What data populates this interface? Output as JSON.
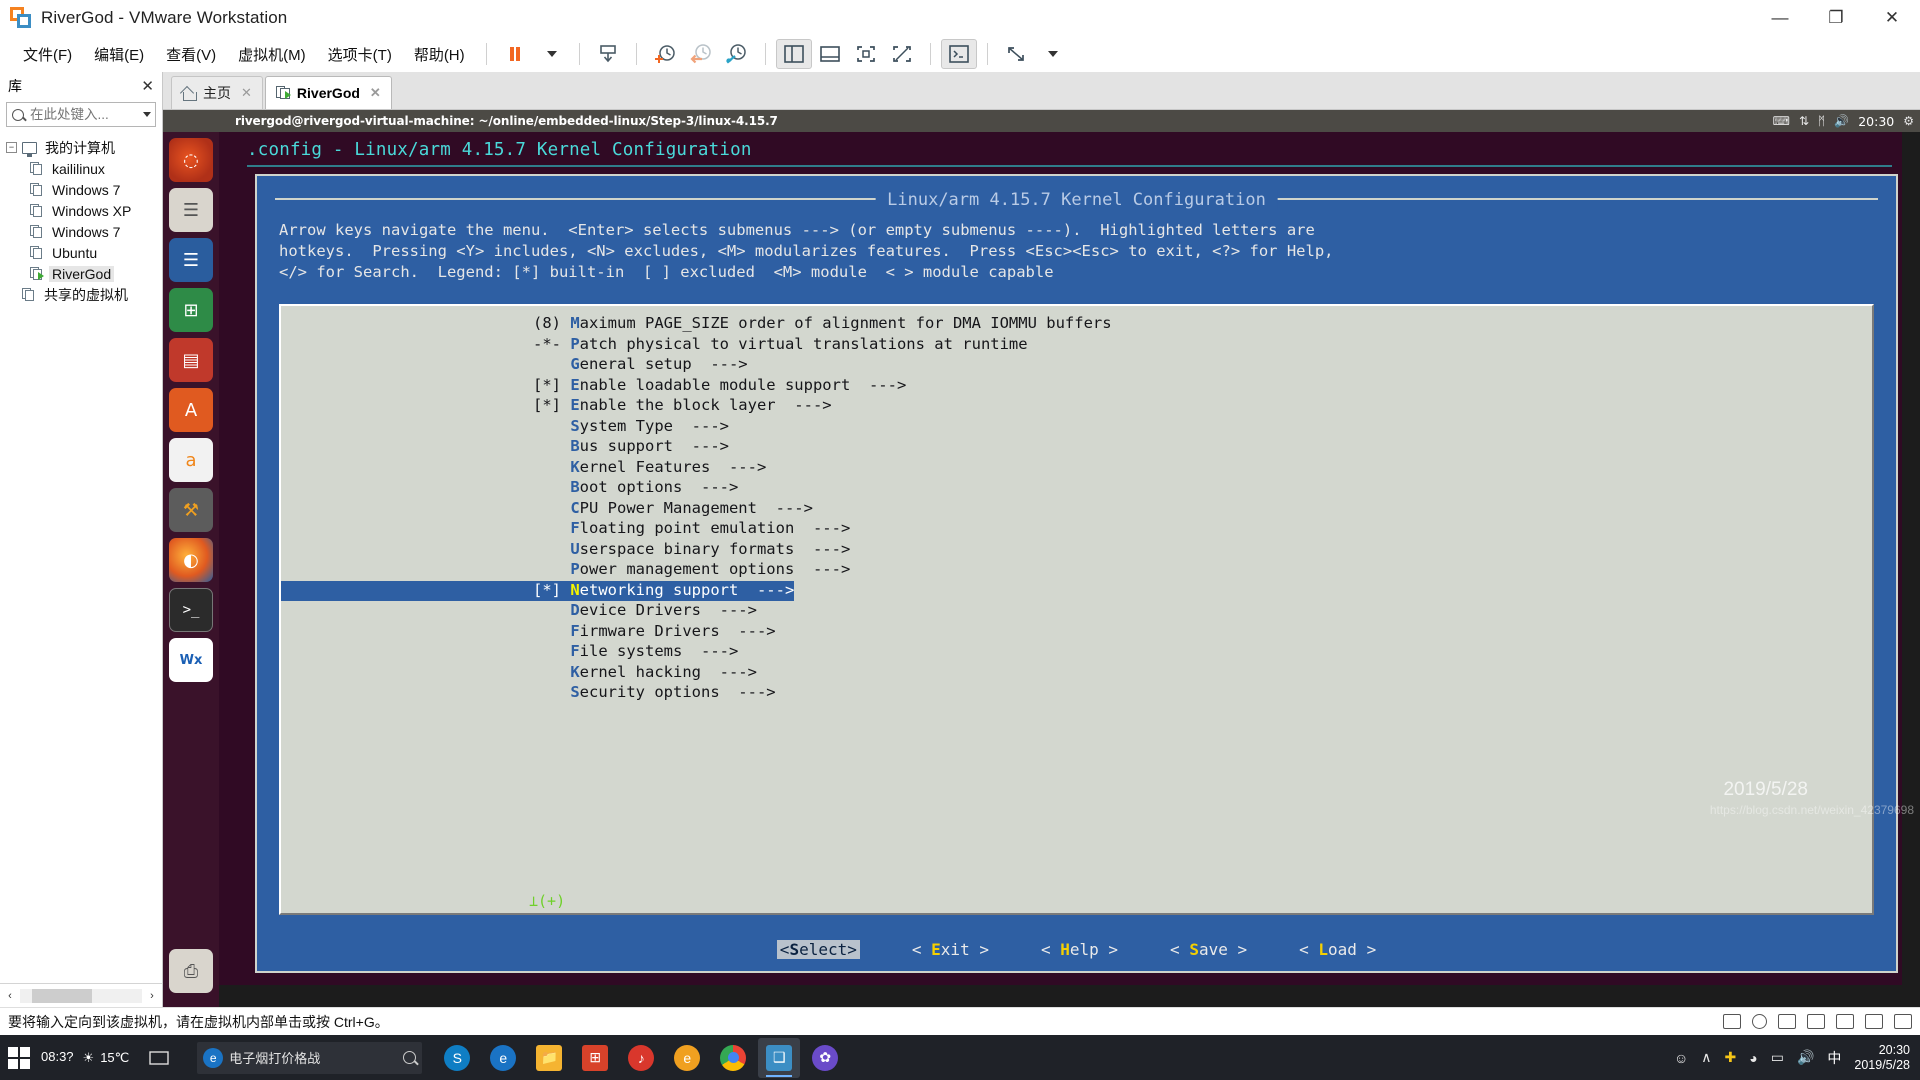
{
  "window": {
    "title": "RiverGod - VMware Workstation",
    "logo_icon": "vmware-logo-icon",
    "controls": {
      "minimize": "—",
      "maximize": "❐",
      "close": "✕"
    }
  },
  "menubar": {
    "items": [
      {
        "label": "文件(F)",
        "name": "menu-file"
      },
      {
        "label": "编辑(E)",
        "name": "menu-edit"
      },
      {
        "label": "查看(V)",
        "name": "menu-view"
      },
      {
        "label": "虚拟机(M)",
        "name": "menu-vm"
      },
      {
        "label": "选项卡(T)",
        "name": "menu-tabs"
      },
      {
        "label": "帮助(H)",
        "name": "menu-help"
      }
    ],
    "toolbar": [
      {
        "name": "suspend-button",
        "icon": "pause-icon"
      },
      {
        "name": "power-dropdown",
        "icon": "chevron-down-icon"
      },
      {
        "name": "send-ctrl-alt-del-button",
        "icon": "keyboard-send-icon"
      },
      {
        "name": "take-snapshot-button",
        "icon": "snapshot-add-icon"
      },
      {
        "name": "revert-snapshot-button",
        "icon": "snapshot-revert-icon"
      },
      {
        "name": "snapshot-manager-button",
        "icon": "snapshot-manager-icon"
      },
      {
        "name": "show-library-button",
        "icon": "panel-left-icon"
      },
      {
        "name": "show-thumbnail-bar-button",
        "icon": "panel-bottom-icon"
      },
      {
        "name": "show-console-view-button",
        "icon": "console-view-icon"
      },
      {
        "name": "hide-console-view-button",
        "icon": "console-hide-icon"
      },
      {
        "name": "unity-mode-button",
        "icon": "terminal-icon"
      },
      {
        "name": "fullscreen-button",
        "icon": "fullscreen-icon"
      },
      {
        "name": "fullscreen-dropdown",
        "icon": "chevron-down-icon"
      }
    ]
  },
  "library": {
    "title": "库",
    "close_icon": "close-icon",
    "search": {
      "placeholder": "在此处键入...",
      "value": "",
      "icon": "search-icon"
    },
    "tree": [
      {
        "label": "我的计算机",
        "type": "root",
        "expanded": true,
        "icon": "monitor-icon",
        "selected": false
      },
      {
        "label": "kaililinux",
        "type": "vm",
        "icon": "vm-icon",
        "selected": false
      },
      {
        "label": "Windows 7",
        "type": "vm",
        "icon": "vm-icon",
        "selected": false
      },
      {
        "label": "Windows XP",
        "type": "vm",
        "icon": "vm-icon",
        "selected": false
      },
      {
        "label": "Windows 7",
        "type": "vm",
        "icon": "vm-icon",
        "selected": false
      },
      {
        "label": "Ubuntu",
        "type": "vm",
        "icon": "vm-icon",
        "selected": false
      },
      {
        "label": "RiverGod",
        "type": "vm-running",
        "icon": "vm-running-icon",
        "selected": true
      },
      {
        "label": "共享的虚拟机",
        "type": "shared",
        "icon": "shared-vms-icon",
        "selected": false
      }
    ],
    "hscroll": {
      "left_arrow": "‹",
      "right_arrow": "›"
    }
  },
  "tabs": [
    {
      "label": "主页",
      "icon": "home-icon",
      "active": false,
      "close_icon": "✕"
    },
    {
      "label": "RiverGod",
      "icon": "vm-running-icon",
      "active": true,
      "close_icon": "✕"
    }
  ],
  "guest": {
    "panel": {
      "window_title": "rivergod@rivergod-virtual-machine: ~/online/embedded-linux/Step-3/linux-4.15.7",
      "tray": [
        {
          "name": "keyboard-indicator-icon",
          "glyph": "⌨"
        },
        {
          "name": "network-icon",
          "glyph": "⇅"
        },
        {
          "name": "bluetooth-icon",
          "glyph": "ᛗ"
        },
        {
          "name": "volume-icon",
          "glyph": "🔊"
        }
      ],
      "clock": "20:30",
      "settings_icon": "gear-icon"
    },
    "launcher": [
      {
        "name": "launcher-ubuntu-dash",
        "label": "",
        "class": "ubuntu",
        "glyph": "◌"
      },
      {
        "name": "launcher-files",
        "label": "",
        "class": "files",
        "glyph": "☰"
      },
      {
        "name": "launcher-writer",
        "label": "",
        "class": "writer",
        "glyph": "☰"
      },
      {
        "name": "launcher-calc",
        "label": "",
        "class": "calc",
        "glyph": "⊞"
      },
      {
        "name": "launcher-impress",
        "label": "",
        "class": "impress",
        "glyph": "▤"
      },
      {
        "name": "launcher-software-center",
        "label": "",
        "class": "soft",
        "glyph": "A"
      },
      {
        "name": "launcher-amazon",
        "label": "",
        "class": "amazon",
        "glyph": "a"
      },
      {
        "name": "launcher-system-settings",
        "label": "",
        "class": "settings",
        "glyph": "⚒"
      },
      {
        "name": "launcher-firefox",
        "label": "",
        "class": "firefox",
        "glyph": "◐"
      },
      {
        "name": "launcher-terminal",
        "label": "",
        "class": "term",
        "glyph": "⌫"
      },
      {
        "name": "launcher-wxhexeditor",
        "label": "",
        "class": "wx",
        "glyph": "Wx"
      },
      {
        "name": "launcher-trash",
        "label": "",
        "class": "trash",
        "glyph": "Ὕ1"
      }
    ],
    "menuconfig": {
      "window_title": ".config - Linux/arm 4.15.7 Kernel Configuration",
      "box_title": "Linux/arm 4.15.7 Kernel Configuration",
      "help_text": "Arrow keys navigate the menu.  <Enter> selects submenus ---> (or empty submenus ----).  Highlighted letters are\nhotkeys.  Pressing <Y> includes, <N> excludes, <M> modularizes features.  Press <Esc><Esc> to exit, <?> for Help,\n</> for Search.  Legend: [*] built-in  [ ] excluded  <M> module  < > module capable",
      "entries": [
        {
          "prefix": "(8) ",
          "hotkey": "M",
          "rest": "aximum PAGE_SIZE order of alignment for DMA IOMMU buffers",
          "suffix": "",
          "selected": false
        },
        {
          "prefix": "-*- ",
          "hotkey": "P",
          "rest": "atch physical to virtual translations at runtime",
          "suffix": "",
          "selected": false
        },
        {
          "prefix": "    ",
          "hotkey": "G",
          "rest": "eneral setup",
          "suffix": "  --->",
          "selected": false
        },
        {
          "prefix": "[*] ",
          "hotkey": "E",
          "rest": "nable loadable module support",
          "suffix": "  --->",
          "selected": false
        },
        {
          "prefix": "[*] ",
          "hotkey": "E",
          "rest": "nable the block layer",
          "suffix": "  --->",
          "selected": false
        },
        {
          "prefix": "    ",
          "hotkey": "S",
          "rest": "ystem Type",
          "suffix": "  --->",
          "selected": false
        },
        {
          "prefix": "    ",
          "hotkey": "B",
          "rest": "us support",
          "suffix": "  --->",
          "selected": false
        },
        {
          "prefix": "    ",
          "hotkey": "K",
          "rest": "ernel Features",
          "suffix": "  --->",
          "selected": false
        },
        {
          "prefix": "    ",
          "hotkey": "B",
          "rest": "oot options",
          "suffix": "  --->",
          "selected": false
        },
        {
          "prefix": "    ",
          "hotkey": "C",
          "rest": "PU Power Management",
          "suffix": "  --->",
          "selected": false
        },
        {
          "prefix": "    ",
          "hotkey": "F",
          "rest": "loating point emulation",
          "suffix": "  --->",
          "selected": false
        },
        {
          "prefix": "    ",
          "hotkey": "U",
          "rest": "serspace binary formats",
          "suffix": "  --->",
          "selected": false
        },
        {
          "prefix": "    ",
          "hotkey": "P",
          "rest": "ower management options",
          "suffix": "  --->",
          "selected": false
        },
        {
          "prefix": "[*] ",
          "hotkey": "N",
          "rest": "etworking support",
          "suffix": "  --->",
          "selected": true
        },
        {
          "prefix": "    ",
          "hotkey": "D",
          "rest": "evice Drivers",
          "suffix": "  --->",
          "selected": false
        },
        {
          "prefix": "    ",
          "hotkey": "F",
          "rest": "irmware Drivers",
          "suffix": "  --->",
          "selected": false
        },
        {
          "prefix": "    ",
          "hotkey": "F",
          "rest": "ile systems",
          "suffix": "  --->",
          "selected": false
        },
        {
          "prefix": "    ",
          "hotkey": "K",
          "rest": "ernel hacking",
          "suffix": "  --->",
          "selected": false
        },
        {
          "prefix": "    ",
          "hotkey": "S",
          "rest": "ecurity options",
          "suffix": "  --->",
          "selected": false
        }
      ],
      "scroll_indicator": "⊥(+)",
      "buttons": [
        {
          "left": "<",
          "hotkey": "S",
          "rest": "elect",
          "right": ">",
          "selected": true
        },
        {
          "left": "<  ",
          "hotkey": "E",
          "rest": "xit  ",
          "right": ">",
          "selected": false
        },
        {
          "left": "<  ",
          "hotkey": "H",
          "rest": "elp  ",
          "right": ">",
          "selected": false
        },
        {
          "left": "<  ",
          "hotkey": "S",
          "rest": "ave  ",
          "right": ">",
          "selected": false
        },
        {
          "left": "<  ",
          "hotkey": "L",
          "rest": "oad  ",
          "right": ">",
          "selected": false
        }
      ]
    }
  },
  "watermarks": {
    "blog": "https://blog.csdn.net/weixin_42379698",
    "date": "2019/5/28"
  },
  "statusbar": {
    "message": "要将输入定向到该虚拟机，请在虚拟机内部单击或按 Ctrl+G。",
    "icons": [
      {
        "name": "hard-disk-indicator-icon"
      },
      {
        "name": "cd-dvd-indicator-icon"
      },
      {
        "name": "network-indicator-icon"
      },
      {
        "name": "usb-indicator-icon"
      },
      {
        "name": "sound-indicator-icon"
      },
      {
        "name": "printer-indicator-icon"
      },
      {
        "name": "display-indicator-icon"
      }
    ]
  },
  "taskbar": {
    "start_icon": "windows-start-icon",
    "time": "08:3?",
    "weather": "15℃",
    "task_view_icon": "task-view-icon",
    "search": {
      "icon": "edge-icon",
      "text": "电子烟打价格战",
      "search_icon": "search-icon"
    },
    "apps": [
      {
        "name": "taskbar-app-skype",
        "glyph": "S",
        "color": "#0f7ec4",
        "active": false
      },
      {
        "name": "taskbar-app-edge",
        "glyph": "e",
        "color": "#1a73c4",
        "active": false
      },
      {
        "name": "taskbar-app-file-explorer",
        "glyph": "📁",
        "color": "#f5b431",
        "active": false
      },
      {
        "name": "taskbar-app-microsoft-store",
        "glyph": "⊞",
        "color": "#d8422a",
        "active": false
      },
      {
        "name": "taskbar-app-netease-music",
        "glyph": "♪",
        "color": "#d9372c",
        "active": false
      },
      {
        "name": "taskbar-app-ebook",
        "glyph": "e",
        "color": "#f0a020",
        "active": false
      },
      {
        "name": "taskbar-app-chrome",
        "glyph": "●",
        "color": "#4285f4",
        "active": false
      },
      {
        "name": "taskbar-app-vmware",
        "glyph": "❑",
        "color": "#3c8ec4",
        "active": true
      },
      {
        "name": "taskbar-app-pinwheel",
        "glyph": "✿",
        "color": "#6a4bc9",
        "active": false
      }
    ],
    "tray": [
      {
        "name": "people-icon",
        "glyph": "὆4"
      },
      {
        "name": "show-hidden-icons-icon",
        "glyph": "∧"
      },
      {
        "name": "security-icon",
        "glyph": "➕"
      },
      {
        "name": "wifi-icon",
        "glyph": "὏6"
      },
      {
        "name": "battery-icon",
        "glyph": "▭"
      },
      {
        "name": "volume-icon",
        "glyph": "🔊"
      },
      {
        "name": "ime-icon",
        "glyph": "中"
      }
    ],
    "clock": {
      "time": "20:30",
      "date": "2019/5/28"
    }
  }
}
